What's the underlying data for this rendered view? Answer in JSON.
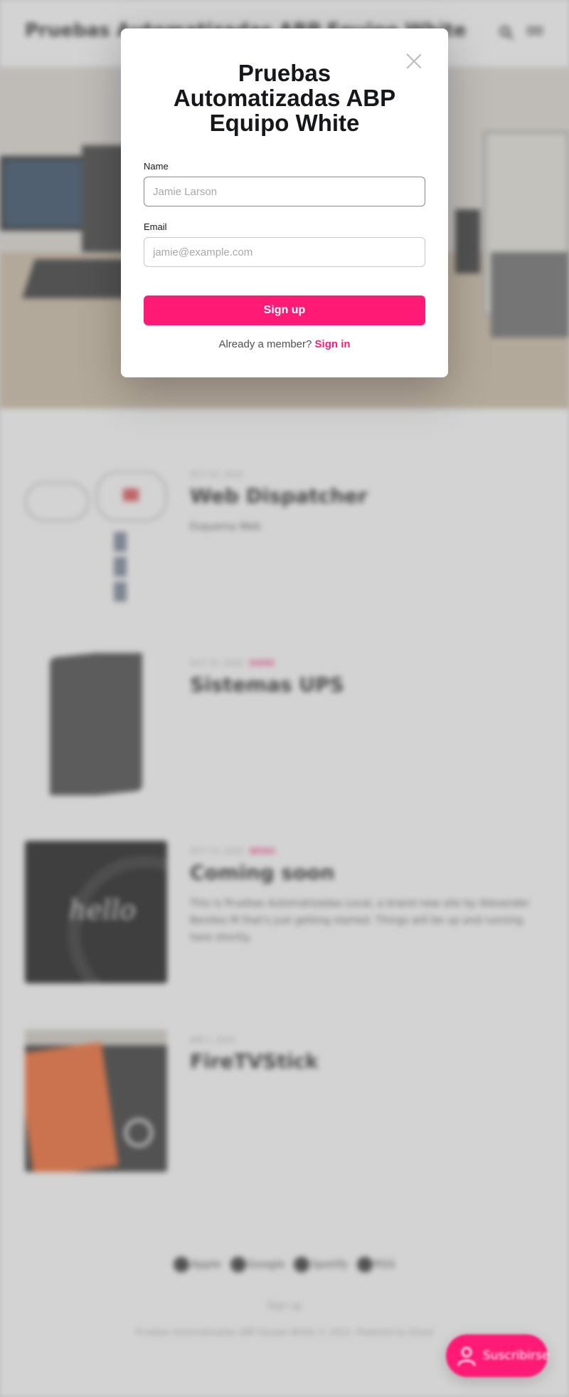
{
  "site": {
    "title": "Pruebas Automatizadas ABP Equipo White"
  },
  "header": {
    "search_icon": "search-icon",
    "menu_icon": "hamburger-menu-icon"
  },
  "posts": [
    {
      "date": "OCT 15, 2022",
      "tag": "",
      "title": "Web Dispatcher",
      "excerpt": "Esquema Web",
      "thumb": "network-diagram"
    },
    {
      "date": "OCT 15, 2022",
      "tag": "EWRE",
      "title": "Sistemas UPS",
      "excerpt": "",
      "thumb": "ups-device"
    },
    {
      "date": "OCT 13, 2022",
      "tag": "NEWS",
      "title": "Coming soon",
      "excerpt": "This is Pruebas Automatizadas Local, a brand new site by Alexander Benitez M that's just getting started. Things will be up and running here shortly.",
      "thumb": "hello-word"
    },
    {
      "date": "JAN 1, 2022",
      "tag": "",
      "title": "FireTVStick",
      "excerpt": "",
      "thumb": "fire-tv-box"
    }
  ],
  "thumb_hello_text": "hello",
  "footer": {
    "links": [
      "Apple",
      "Google",
      "Spotify",
      "RSS"
    ],
    "signup": "Sign up",
    "copyright": "Pruebas Automatizadas ABP Equipo White © 2022. Powered by Ghost"
  },
  "portal_trigger": {
    "label": "Suscribirse",
    "icon": "user-icon"
  },
  "modal": {
    "title": "Pruebas Automatizadas ABP Equipo White",
    "name_label": "Name",
    "name_placeholder": "Jamie Larson",
    "email_label": "Email",
    "email_placeholder": "jamie@example.com",
    "submit_label": "Sign up",
    "member_text": "Already a member?",
    "signin_label": "Sign in",
    "close_icon": "close-icon"
  },
  "colors": {
    "accent": "#ff1a75",
    "text": "#15171a",
    "overlay": "#969696"
  }
}
